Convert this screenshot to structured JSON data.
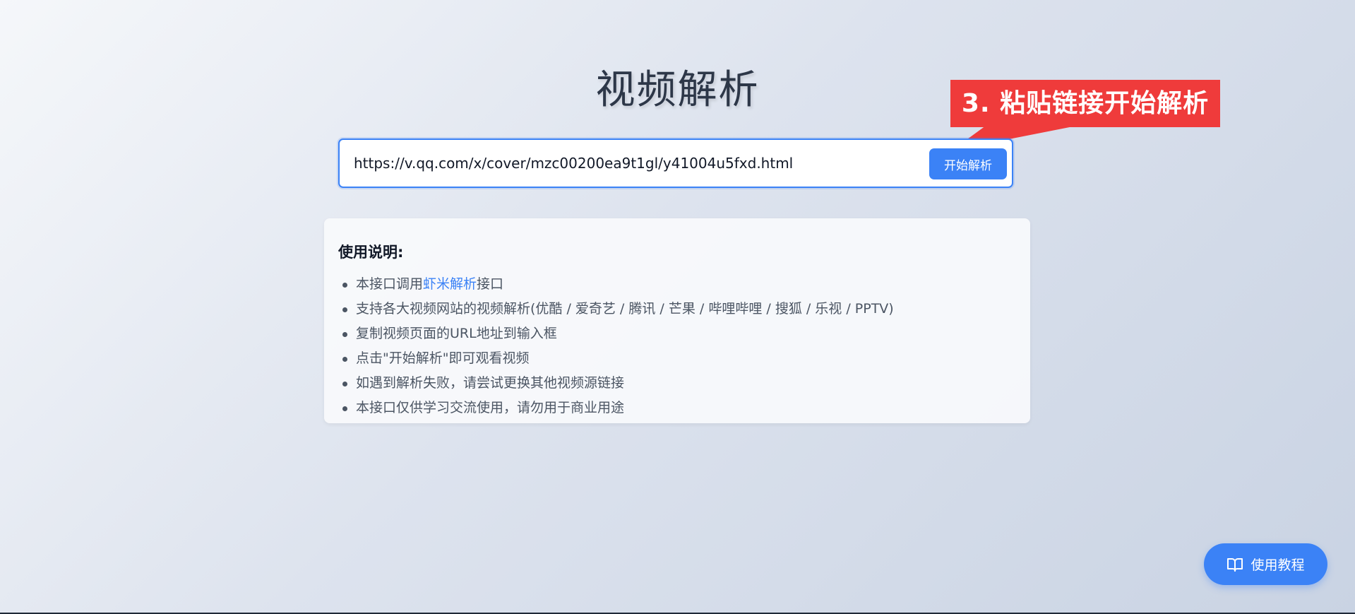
{
  "page": {
    "title": "视频解析"
  },
  "search": {
    "value": "https://v.qq.com/x/cover/mzc00200ea9t1gl/y41004u5fxd.html",
    "button_label": "开始解析"
  },
  "annotation": {
    "text": "3. 粘贴链接开始解析",
    "color": "#ef3b3b"
  },
  "info": {
    "title": "使用说明:",
    "items": [
      {
        "prefix": "本接口调用",
        "link": "虾米解析",
        "suffix": "接口"
      },
      {
        "text": "支持各大视频网站的视频解析(优酷 / 爱奇艺 / 腾讯 / 芒果 / 哔哩哔哩 / 搜狐 / 乐视 / PPTV)"
      },
      {
        "text": "复制视频页面的URL地址到输入框"
      },
      {
        "text": "点击\"开始解析\"即可观看视频"
      },
      {
        "text": "如遇到解析失败，请尝试更换其他视频源链接"
      },
      {
        "text": "本接口仅供学习交流使用，请勿用于商业用途"
      }
    ]
  },
  "tutorial": {
    "label": "使用教程",
    "icon": "book-icon"
  },
  "colors": {
    "accent": "#3b82f6",
    "title": "#2d3748"
  }
}
